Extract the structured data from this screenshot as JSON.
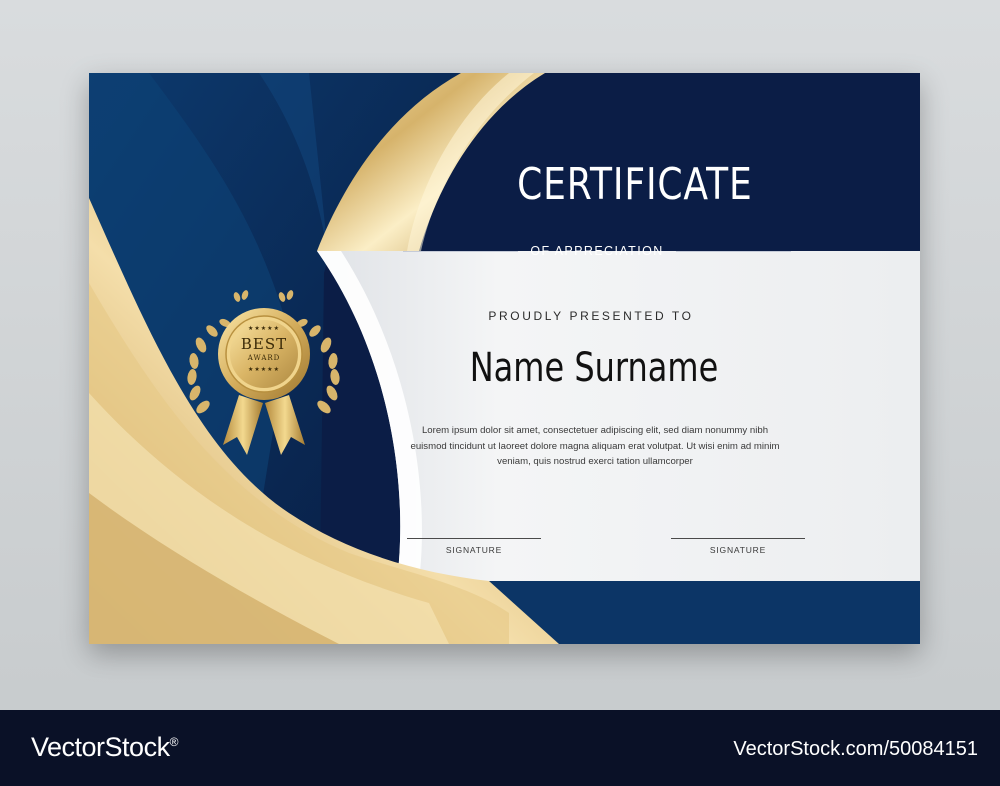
{
  "certificate": {
    "title": "CERTIFICATE",
    "subtitle": "OF APPRECIATION",
    "presented_label": "PROUDLY PRESENTED TO",
    "recipient_name": "Name Surname",
    "body_text": "Lorem ipsum dolor sit amet, consectetuer adipiscing elit, sed diam nonummy nibh euismod tincidunt ut laoreet dolore magna aliquam erat volutpat. Ut wisi enim ad minim veniam, quis nostrud exerci tation ullamcorper",
    "signatures": [
      {
        "label": "SIGNATURE"
      },
      {
        "label": "SIGNATURE"
      }
    ],
    "seal": {
      "line1": "BEST",
      "line2": "AWARD",
      "stars": "★★★★★",
      "icon": "award-ribbon-icon"
    }
  },
  "watermark": {
    "logo_text": "VectorStock",
    "registered_mark": "®",
    "image_id": "VectorStock.com/50084151"
  },
  "colors": {
    "navy": "#0b1f4a",
    "deep_blue": "#0c3566",
    "gold": "#d9b66e",
    "panel": "#f1f2f4",
    "footer": "#0a1127"
  }
}
